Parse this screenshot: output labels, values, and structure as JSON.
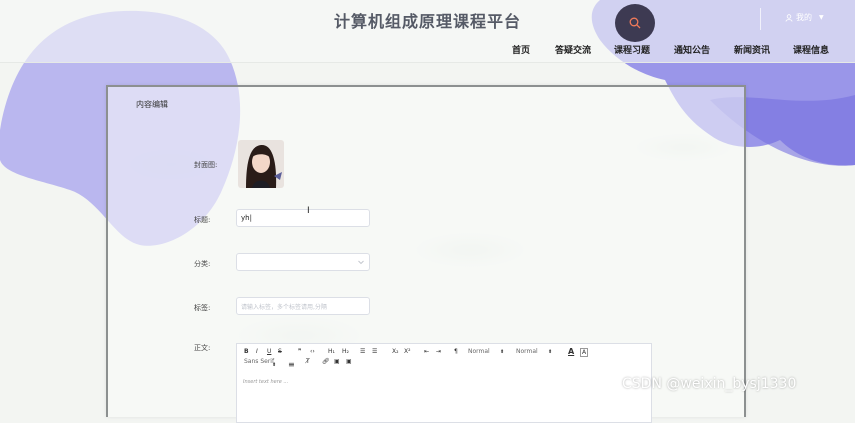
{
  "site": {
    "title": "计算机组成原理课程平台"
  },
  "header": {
    "user_label": "我的",
    "search_icon": "search-icon",
    "user_icon": "user-icon"
  },
  "nav": {
    "items": [
      "首页",
      "答疑交流",
      "课程习题",
      "通知公告",
      "新闻资讯",
      "课程信息"
    ]
  },
  "form": {
    "panel_title": "内容编辑",
    "cover_label": "封面图:",
    "title_label": "标题:",
    "title_value": "yh|",
    "category_label": "分类:",
    "category_value": "",
    "tags_label": "标签:",
    "tags_placeholder": "请输入标签，多个标签请用,分隔",
    "body_label": "正文:",
    "body_placeholder": "Insert text here ..."
  },
  "editor": {
    "font_family": "Sans Serif",
    "heading": "Normal",
    "size": "Normal"
  },
  "watermark": "CSDN @weixin_bysj1330",
  "colors": {
    "blob_purple": "#8a85e8",
    "search_bg": "#3d3a52",
    "panel_border": "#8c9090"
  }
}
